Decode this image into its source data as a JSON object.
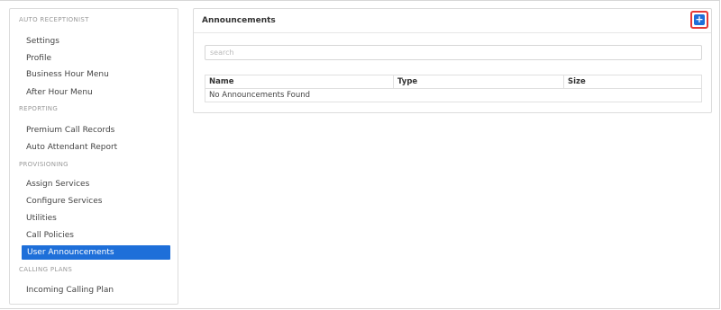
{
  "sidebar": {
    "sections": [
      {
        "title": "AUTO RECEPTIONIST",
        "items": [
          "Settings",
          "Profile",
          "Business Hour Menu",
          "After Hour Menu"
        ]
      },
      {
        "title": "REPORTING",
        "items": [
          "Premium Call Records",
          "Auto Attendant Report"
        ]
      },
      {
        "title": "PROVISIONING",
        "items": [
          "Assign Services",
          "Configure Services",
          "Utilities",
          "Call Policies",
          "User Announcements"
        ]
      },
      {
        "title": "CALLING PLANS",
        "items": [
          "Incoming Calling Plan"
        ]
      }
    ],
    "active_item": "User Announcements"
  },
  "panel": {
    "title": "Announcements",
    "add_button": {
      "label": "+",
      "icon": "plus-icon",
      "highlight_color": "#e53935"
    },
    "search": {
      "placeholder": "search",
      "value": ""
    },
    "table": {
      "columns": [
        "Name",
        "Type",
        "Size"
      ],
      "empty_message": "No Announcements Found"
    }
  },
  "colors": {
    "accent": "#1e6fd9",
    "highlight": "#e53935"
  }
}
